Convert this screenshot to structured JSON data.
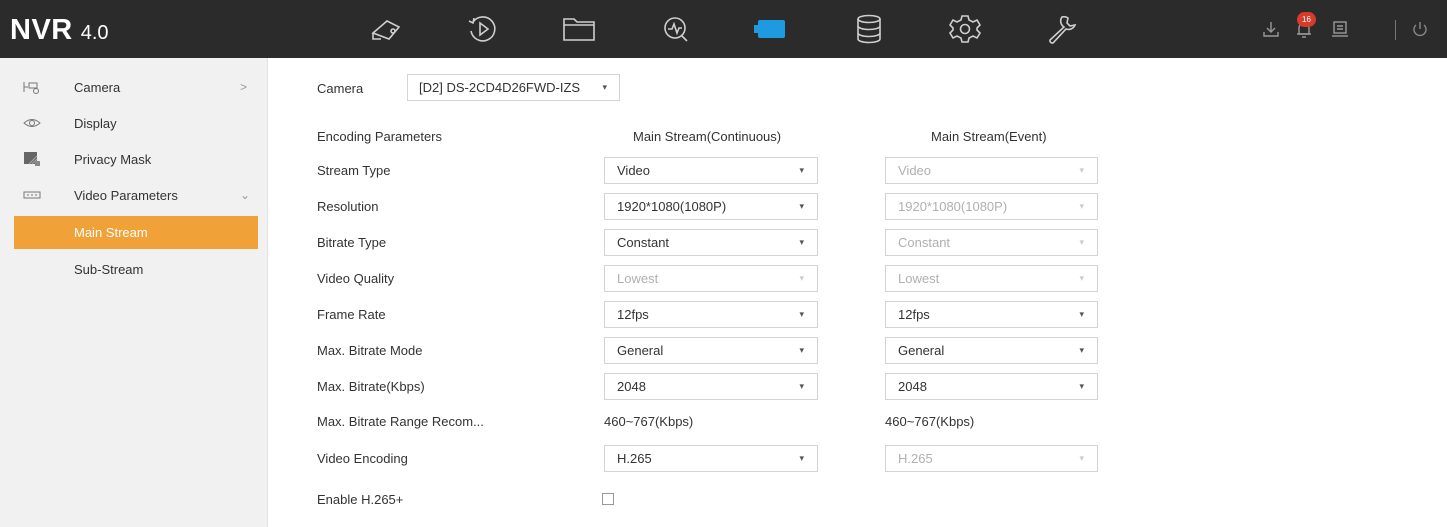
{
  "app": {
    "logo": "NVR",
    "version": "4.0"
  },
  "topbar": {
    "icons": [
      "live-view-icon",
      "playback-icon",
      "file-management-icon",
      "smart-analysis-icon",
      "camera-icon",
      "storage-icon",
      "system-settings-icon",
      "maintenance-icon"
    ],
    "active_icon": "camera-icon",
    "accent": "#1e9be0",
    "right_icons": [
      "download-icon",
      "alarm-bell-icon",
      "export-icon",
      "power-icon"
    ],
    "notification_count": "16"
  },
  "sidebar": {
    "items": [
      {
        "label": "Camera",
        "icon": "camera-list-icon",
        "chevron": ">"
      },
      {
        "label": "Display",
        "icon": "eye-icon"
      },
      {
        "label": "Privacy Mask",
        "icon": "privacy-mask-icon"
      },
      {
        "label": "Video Parameters",
        "icon": "video-parameters-icon",
        "chevron": "⌄"
      }
    ],
    "sub_items": [
      {
        "label": "Main Stream",
        "active": true
      },
      {
        "label": "Sub-Stream",
        "active": false
      }
    ],
    "active_color": "#f0a239"
  },
  "main": {
    "camera_label": "Camera",
    "camera_value": "[D2] DS-2CD4D26FWD-IZS",
    "header": {
      "params": "Encoding Parameters",
      "continuous": "Main Stream(Continuous)",
      "event": "Main Stream(Event)"
    },
    "rows": [
      {
        "label": "Stream Type",
        "continuous": "Video",
        "event": "Video"
      },
      {
        "label": "Resolution",
        "continuous": "1920*1080(1080P)",
        "event": "1920*1080(1080P)"
      },
      {
        "label": "Bitrate Type",
        "continuous": "Constant",
        "event": "Constant"
      },
      {
        "label": "Video Quality",
        "continuous": "Lowest",
        "event": "Lowest"
      },
      {
        "label": "Frame Rate",
        "continuous": "12fps",
        "event": "12fps"
      },
      {
        "label": "Max. Bitrate Mode",
        "continuous": "General",
        "event": "General"
      },
      {
        "label": "Max. Bitrate(Kbps)",
        "continuous": "2048",
        "event": "2048"
      },
      {
        "label": "Max. Bitrate Range Recom...",
        "continuous": "460~767(Kbps)",
        "event": "460~767(Kbps)"
      },
      {
        "label": "Video Encoding",
        "continuous": "H.265",
        "event": "H.265"
      },
      {
        "label": "Enable H.265+"
      }
    ],
    "enable_h265plus": false
  }
}
